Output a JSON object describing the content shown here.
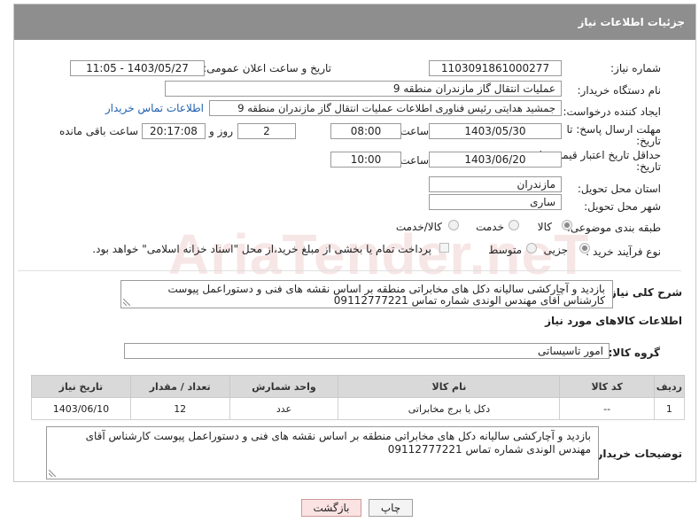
{
  "header": {
    "title": "جزئیات اطلاعات نیاز"
  },
  "watermark": {
    "text": "AriaTender.neT"
  },
  "fields": {
    "need_number_label": "شماره نیاز:",
    "need_number": "1103091861000277",
    "announce_label": "تاریخ و ساعت اعلان عمومی:",
    "announce_value": "1403/05/27 - 11:05",
    "buyer_org_label": "نام دستگاه خریدار:",
    "buyer_org": "عملیات انتقال گاز مازندران منطقه 9",
    "creator_label": "ایجاد کننده درخواست:",
    "creator": "جمشید هدایتی رئیس فناوری اطلاعات عملیات انتقال گاز مازندران منطقه 9",
    "contact_link": "اطلاعات تماس خریدار",
    "deadline_label_1": "مهلت ارسال پاسخ: تا",
    "deadline_label_2": "تاریخ:",
    "deadline_date": "1403/05/30",
    "deadline_hour_label": "ساعت",
    "deadline_hour": "08:00",
    "days_value": "2",
    "days_label": "روز و",
    "remaining_time": "20:17:08",
    "remaining_label": "ساعت باقی مانده",
    "validity_label_1": "حداقل تاریخ اعتبار قیمت: تا",
    "validity_label_2": "تاریخ:",
    "validity_date": "1403/06/20",
    "validity_hour_label": "ساعت",
    "validity_hour": "10:00",
    "province_label": "استان محل تحویل:",
    "province": "مازندران",
    "city_label": "شهر محل تحویل:",
    "city": "ساری",
    "category_label": "طبقه بندی موضوعی:",
    "category_options": [
      "کالا",
      "خدمت",
      "کالا/خدمت"
    ],
    "process_label": "نوع فرآیند خرید :",
    "process_options": [
      "جزیی",
      "متوسط"
    ],
    "payment_note": "پرداخت تمام یا بخشی از مبلغ خرید،از محل \"اسناد خزانه اسلامی\" خواهد بود.",
    "description_label": "شرح کلی نیاز:",
    "description": "بازدید و آچارکشی سالیانه دکل های مخابراتی منطقه  بر اساس نقشه های فنی و دستوراعمل پیوست کارشناس آقای مهندس الوندی شماره تماس 09112777221"
  },
  "goods": {
    "section_title": "اطلاعات کالاهای مورد نیاز",
    "group_label": "گروه کالا:",
    "group_value": "امور تاسیساتی",
    "columns": [
      "ردیف",
      "کد کالا",
      "نام کالا",
      "واحد شمارش",
      "تعداد / مقدار",
      "تاریخ نیاز"
    ],
    "rows": [
      [
        "1",
        "--",
        "دکل یا برج مخابراتی",
        "عدد",
        "12",
        "1403/06/10"
      ]
    ]
  },
  "buyer_notes": {
    "label": "توضیحات خریدار:",
    "text": "بازدید و آچارکشی سالیانه دکل های مخابراتی منطقه  بر اساس نقشه های فنی و دستوراعمل پیوست کارشناس آقای مهندس الوندی شماره تماس 09112777221"
  },
  "buttons": {
    "print": "چاپ",
    "back": "بازگشت"
  },
  "colors": {
    "header_bg": "#8e8e8e",
    "link": "#1f5fae",
    "back_button_bg": "#fbe3e3"
  }
}
